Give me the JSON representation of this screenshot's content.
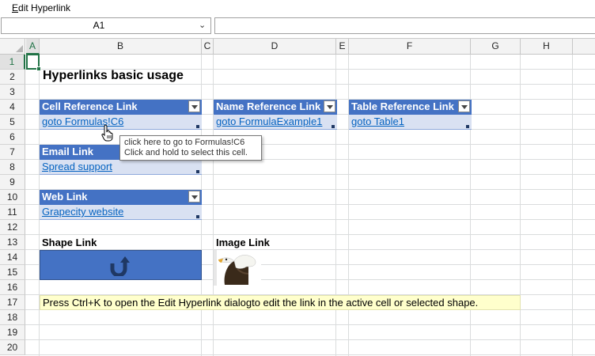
{
  "menu": {
    "edit_prefix": "E",
    "edit_rest": "dit Hyperlink"
  },
  "namebox": {
    "value": "A1"
  },
  "formula": {
    "value": ""
  },
  "columns": [
    "A",
    "B",
    "C",
    "D",
    "E",
    "F",
    "G",
    "H"
  ],
  "rows": [
    "1",
    "2",
    "3",
    "4",
    "5",
    "6",
    "7",
    "8",
    "9",
    "10",
    "11",
    "12",
    "13",
    "14",
    "15",
    "16",
    "17",
    "18",
    "19",
    "20"
  ],
  "sheet": {
    "title": "Hyperlinks basic usage",
    "cell_ref_header": "Cell Reference Link",
    "cell_ref_link": "goto Formulas!C6",
    "name_ref_header": "Name Reference Link",
    "name_ref_link": "goto FormulaExample1",
    "table_ref_header": "Table Reference Link",
    "table_ref_link": "goto Table1",
    "email_header": "Email Link",
    "email_link": "Spread support",
    "web_header": "Web Link",
    "web_link": "Grapecity website",
    "shape_label": "Shape Link",
    "image_label": "Image Link",
    "note": "Press Ctrl+K to open the Edit Hyperlink dialogto edit the link in the active cell or selected shape."
  },
  "tooltip": {
    "line1": "click here to go to Formulas!C6",
    "line2": "Click and hold to select this cell."
  },
  "colors": {
    "header_blue": "#4472c4",
    "row_blue": "#d9e1f2",
    "link": "#0563c1",
    "excel_green": "#217346",
    "note_yellow": "#ffffcc"
  },
  "icons": {
    "shape": "u-turn-arrow-icon",
    "cursor": "hand-pointer-icon",
    "image": "eagle-image"
  }
}
